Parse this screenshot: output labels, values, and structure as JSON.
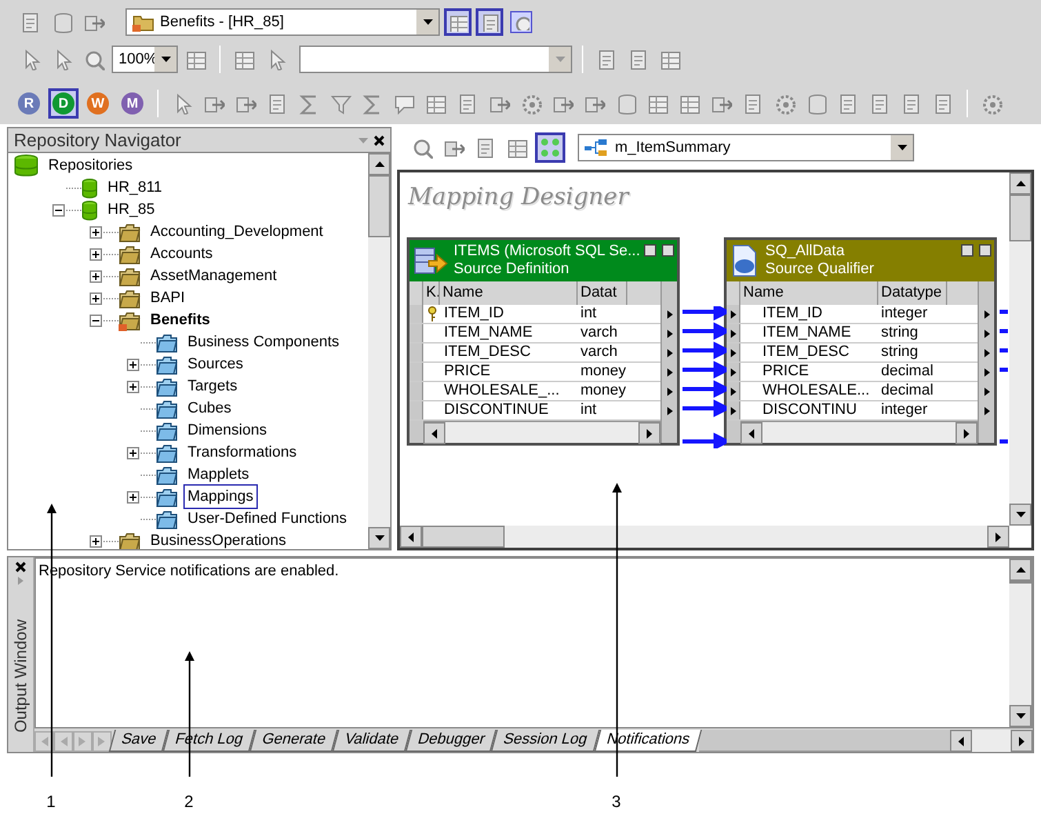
{
  "toolbar": {
    "folder_select": {
      "value": "Benefits - [HR_85]"
    },
    "zoom_select": {
      "value": "100%"
    },
    "tool_buttons": [
      {
        "label": "R",
        "color": "#6b7bb8",
        "selected": false
      },
      {
        "label": "D",
        "color": "#119933",
        "selected": true
      },
      {
        "label": "W",
        "color": "#e07020",
        "selected": false
      },
      {
        "label": "M",
        "color": "#8060b0",
        "selected": false
      }
    ]
  },
  "navigator": {
    "title": "Repository Navigator",
    "tree": [
      {
        "label": "Repositories",
        "kind": "root",
        "selected": false,
        "children": [
          {
            "label": "HR_811",
            "kind": "repository",
            "selected": false
          },
          {
            "label": "HR_85",
            "kind": "repository",
            "selected": false,
            "expanded": true,
            "children": [
              {
                "label": "Accounting_Development",
                "kind": "folder",
                "selected": false,
                "expanded": false,
                "open": false
              },
              {
                "label": "Accounts",
                "kind": "folder",
                "selected": false,
                "expanded": false,
                "open": false
              },
              {
                "label": "AssetManagement",
                "kind": "folder",
                "selected": false,
                "expanded": false,
                "open": false
              },
              {
                "label": "BAPI",
                "kind": "folder",
                "selected": false,
                "expanded": false,
                "open": false
              },
              {
                "label": "Benefits",
                "kind": "folder",
                "selected": false,
                "expanded": true,
                "open": true,
                "children": [
                  {
                    "label": "Business Components",
                    "kind": "node",
                    "selected": false
                  },
                  {
                    "label": "Sources",
                    "kind": "node",
                    "selected": false,
                    "expanded": false
                  },
                  {
                    "label": "Targets",
                    "kind": "node",
                    "selected": false,
                    "expanded": false
                  },
                  {
                    "label": "Cubes",
                    "kind": "node",
                    "selected": false
                  },
                  {
                    "label": "Dimensions",
                    "kind": "node",
                    "selected": false
                  },
                  {
                    "label": "Transformations",
                    "kind": "node",
                    "selected": false,
                    "expanded": false
                  },
                  {
                    "label": "Mapplets",
                    "kind": "node",
                    "selected": false
                  },
                  {
                    "label": "Mappings",
                    "kind": "node",
                    "selected": true,
                    "expanded": false
                  },
                  {
                    "label": "User-Defined Functions",
                    "kind": "node",
                    "selected": false
                  }
                ]
              },
              {
                "label": "BusinessOperations",
                "kind": "folder",
                "selected": false,
                "expanded": false,
                "open": false
              }
            ]
          }
        ]
      }
    ]
  },
  "designer": {
    "mapping_select": {
      "value": "m_ItemSummary"
    },
    "title": "Mapping Designer",
    "transformations": [
      {
        "kind": "source",
        "title": "ITEMS (Microsoft SQL Se...",
        "subtitle": "Source Definition",
        "color": "#008a1c",
        "columns": [
          "K.",
          "Name",
          "Datat"
        ],
        "rows": [
          {
            "key": true,
            "name": "ITEM_ID",
            "datatype": "int"
          },
          {
            "key": false,
            "name": "ITEM_NAME",
            "datatype": "varch"
          },
          {
            "key": false,
            "name": "ITEM_DESC",
            "datatype": "varch"
          },
          {
            "key": false,
            "name": "PRICE",
            "datatype": "money"
          },
          {
            "key": false,
            "name": "WHOLESALE_...",
            "datatype": "money"
          },
          {
            "key": false,
            "name": "DISCONTINUE",
            "datatype": "int"
          }
        ]
      },
      {
        "kind": "qualifier",
        "title": "SQ_AllData",
        "subtitle": "Source Qualifier",
        "color": "#857f00",
        "columns": [
          "Name",
          "Datatype"
        ],
        "rows": [
          {
            "name": "ITEM_ID",
            "datatype": "integer"
          },
          {
            "name": "ITEM_NAME",
            "datatype": "string"
          },
          {
            "name": "ITEM_DESC",
            "datatype": "string"
          },
          {
            "name": "PRICE",
            "datatype": "decimal"
          },
          {
            "name": "WHOLESALE...",
            "datatype": "decimal"
          },
          {
            "name": "DISCONTINU",
            "datatype": "integer"
          }
        ]
      }
    ]
  },
  "output_window": {
    "title": "Output Window",
    "message": "Repository Service notifications are enabled.",
    "tabs": [
      {
        "label": "Save",
        "selected": false
      },
      {
        "label": "Fetch Log",
        "selected": false
      },
      {
        "label": "Generate",
        "selected": false
      },
      {
        "label": "Validate",
        "selected": false
      },
      {
        "label": "Debugger",
        "selected": false
      },
      {
        "label": "Session Log",
        "selected": false
      },
      {
        "label": "Notifications",
        "selected": true
      }
    ]
  },
  "callouts": [
    {
      "label": "1"
    },
    {
      "label": "2"
    },
    {
      "label": "3"
    }
  ]
}
